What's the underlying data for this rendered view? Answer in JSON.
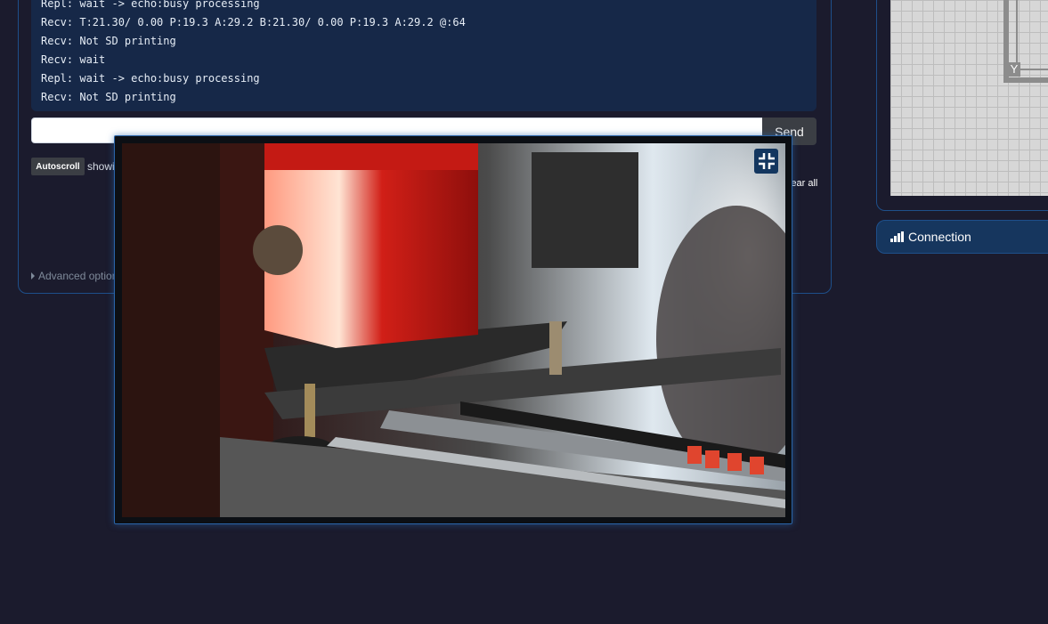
{
  "terminal": {
    "lines": [
      "Repl: wait -> echo:busy processing",
      "Recv: T:21.30/ 0.00 P:19.3 A:29.2 B:21.30/ 0.00 P:19.3 A:29.2 @:64",
      "Recv: Not SD printing",
      "Recv: wait",
      "Repl: wait -> echo:busy processing",
      "Recv: Not SD printing"
    ],
    "command_placeholder": "",
    "send_label": "Send",
    "autoscroll_label": "Autoscroll",
    "showing_text": "showin",
    "clear_all_label": "Clear all",
    "advanced_options_label": "Advanced option"
  },
  "gcode_viewer": {
    "axis_label": "Y"
  },
  "connection": {
    "title": "Connection",
    "icon": "signal-icon"
  },
  "webcam": {
    "exit_fullscreen_icon": "compress-icon"
  },
  "colors": {
    "page_bg": "#1b1b2d",
    "panel_border": "#1e4f8a",
    "terminal_bg": "#162848",
    "button_bg": "#3b3e44",
    "connection_bg": "#16365e",
    "accent": "#2a64a8"
  }
}
